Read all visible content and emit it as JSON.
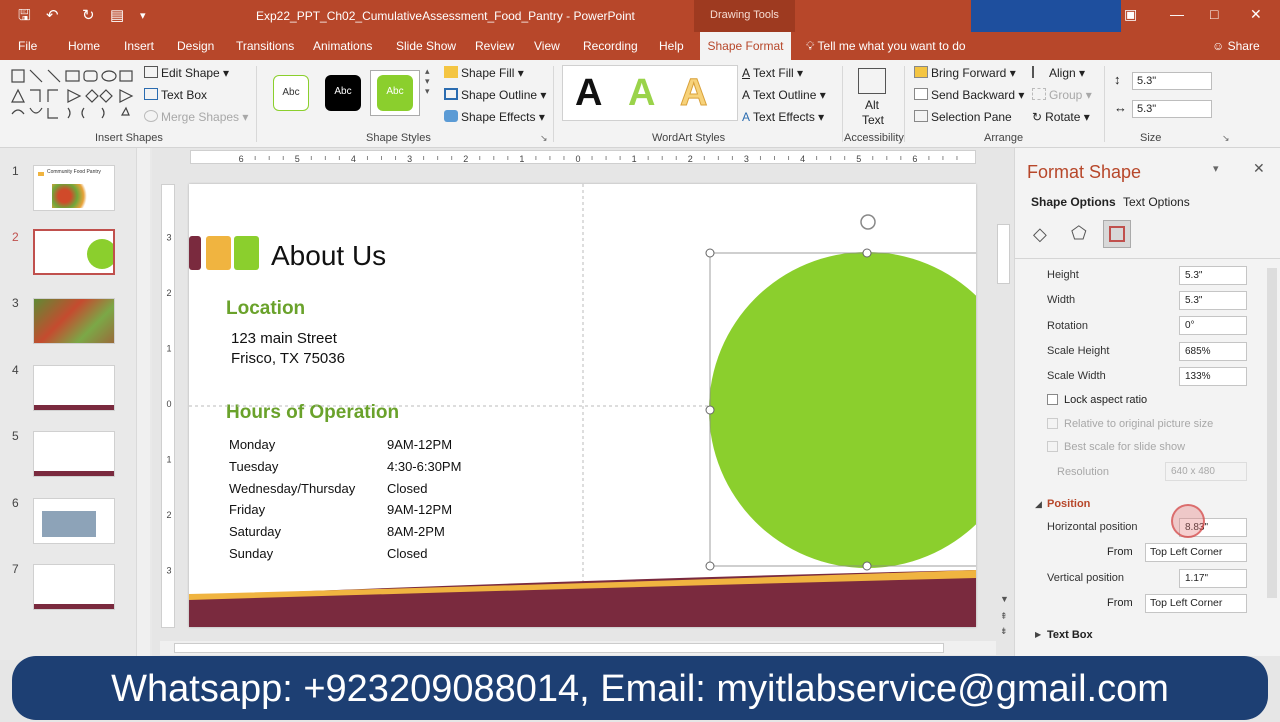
{
  "titlebar": {
    "doc_title": "Exp22_PPT_Ch02_CumulativeAssessment_Food_Pantry  -  PowerPoint",
    "context_tab": "Drawing Tools",
    "qat_icons": [
      "save-icon",
      "undo-icon",
      "redo-icon",
      "present-icon",
      "customize-icon"
    ]
  },
  "tabs": [
    "File",
    "Home",
    "Insert",
    "Design",
    "Transitions",
    "Animations",
    "Slide Show",
    "Review",
    "View",
    "Recording",
    "Help"
  ],
  "active_tab": "Shape Format",
  "tell_me": "Tell me what you want to do",
  "share": "Share",
  "ribbon": {
    "insert_shapes": {
      "edit_shape": "Edit Shape",
      "text_box": "Text Box",
      "merge_shapes": "Merge Shapes",
      "label": "Insert Shapes"
    },
    "shape_styles": {
      "sample": "Abc",
      "fill": "Shape Fill",
      "outline": "Shape Outline",
      "effects": "Shape Effects",
      "label": "Shape Styles"
    },
    "wordart": {
      "letter": "A",
      "fill": "Text Fill",
      "outline": "Text Outline",
      "effects": "Text Effects",
      "label": "WordArt Styles"
    },
    "accessibility": {
      "alt_text_1": "Alt",
      "alt_text_2": "Text",
      "label": "Accessibility"
    },
    "arrange": {
      "bring_forward": "Bring Forward",
      "send_backward": "Send Backward",
      "selection_pane": "Selection Pane",
      "align": "Align",
      "group": "Group",
      "rotate": "Rotate",
      "label": "Arrange"
    },
    "size": {
      "height": "5.3\"",
      "width": "5.3\"",
      "label": "Size"
    }
  },
  "slides": [
    "1",
    "2",
    "3",
    "4",
    "5",
    "6",
    "7"
  ],
  "slide1_title": "Community Food Pantry",
  "slide": {
    "heading": "About Us",
    "location_heading": "Location",
    "address_line1": "123 main Street",
    "address_line2": "Frisco, TX 75036",
    "hours_heading": "Hours of Operation",
    "hours": [
      {
        "day": "Monday",
        "time": "9AM-12PM"
      },
      {
        "day": "Tuesday",
        "time": "4:30-6:30PM"
      },
      {
        "day": "Wednesday/Thursday",
        "time": "Closed"
      },
      {
        "day": "Friday",
        "time": "9AM-12PM"
      },
      {
        "day": "Saturday",
        "time": "8AM-2PM"
      },
      {
        "day": "Sunday",
        "time": "Closed"
      }
    ],
    "colors": {
      "maroon": "#7a2a3e",
      "gold": "#f0b440",
      "green": "#8bcf2d",
      "heading_green": "#6aa22b"
    }
  },
  "ruler_ticks": [
    "6",
    "5",
    "4",
    "3",
    "2",
    "1",
    "0",
    "1",
    "2",
    "3",
    "4",
    "5",
    "6"
  ],
  "vruler_ticks": [
    "3",
    "2",
    "1",
    "0",
    "1",
    "2",
    "3"
  ],
  "format_pane": {
    "title": "Format Shape",
    "tab_shape_options": "Shape Options",
    "tab_text_options": "Text Options",
    "height_label": "Height",
    "height_value": "5.3\"",
    "width_label": "Width",
    "width_value": "5.3\"",
    "rotation_label": "Rotation",
    "rotation_value": "0°",
    "scale_height_label": "Scale Height",
    "scale_height_value": "685%",
    "scale_width_label": "Scale Width",
    "scale_width_value": "133%",
    "lock_aspect": "Lock aspect ratio",
    "relative_original": "Relative to original picture size",
    "best_scale": "Best scale for slide show",
    "resolution_label": "Resolution",
    "resolution_value": "640 x 480",
    "position_section": "Position",
    "horizontal_label": "Horizontal position",
    "horizontal_value": "8.83\"",
    "from_label": "From",
    "from_value": "Top Left Corner",
    "vertical_label": "Vertical position",
    "vertical_value": "1.17\"",
    "text_box_section": "Text Box"
  },
  "banner": "Whatsapp: +923209088014, Email: myitlabservice@gmail.com"
}
